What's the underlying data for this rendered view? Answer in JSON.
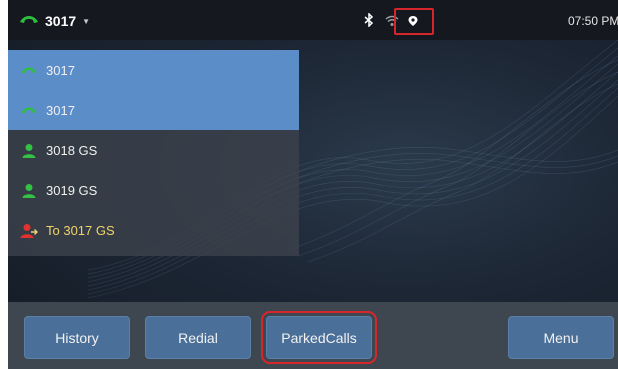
{
  "status_bar": {
    "account": "3017",
    "time": "07:50 PM",
    "icons": [
      "phone-handset-icon",
      "dropdown-caret-icon",
      "bluetooth-icon",
      "wifi-icon",
      "location-pin-icon"
    ],
    "colors": {
      "handset": "#2fbf3f",
      "highlight": "#d6262c"
    }
  },
  "call_list": [
    {
      "label": "3017",
      "icon": "phone-handset-icon",
      "active": true
    },
    {
      "label": "3017",
      "icon": "phone-handset-icon",
      "active": true
    },
    {
      "label": "3018 GS",
      "icon": "contact-icon",
      "active": false
    },
    {
      "label": "3019 GS",
      "icon": "contact-icon",
      "active": false
    },
    {
      "label": "To 3017 GS",
      "icon": "transfer-contact-icon",
      "active": false
    }
  ],
  "softkeys": {
    "history": "History",
    "redial": "Redial",
    "parked_calls": "ParkedCalls",
    "menu": "Menu"
  }
}
